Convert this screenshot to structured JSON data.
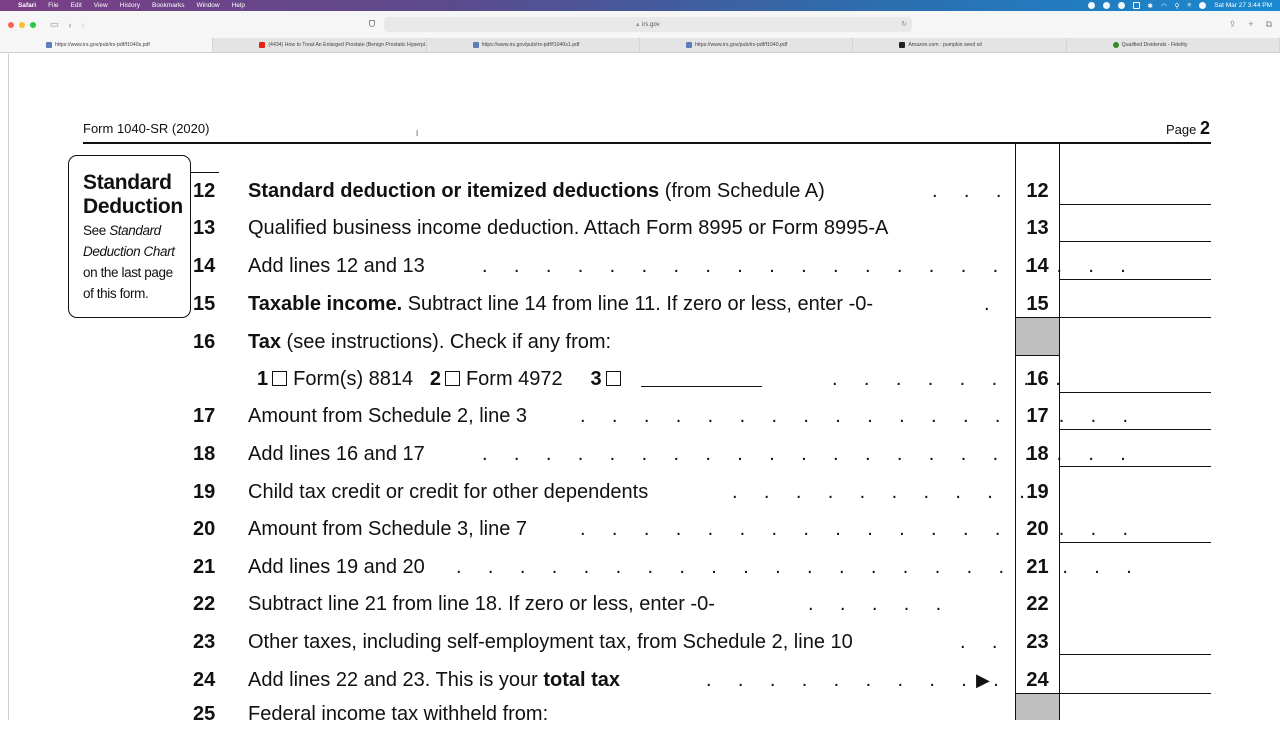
{
  "menubar": {
    "app": "Safari",
    "items": [
      "File",
      "Edit",
      "View",
      "History",
      "Bookmarks",
      "Window",
      "Help"
    ],
    "clock": "Sat Mar 27  3:44 PM"
  },
  "toolbar": {
    "address": "irs.gov",
    "back_icon": "chevron-left",
    "forward_icon": "chevron-right"
  },
  "tabs": [
    {
      "label": "https://www.irs.gov/pub/irs-pdf/f1040s.pdf",
      "favicon": "irs",
      "active": true
    },
    {
      "label": "(4434) How to Treat An Enlarged Prostate (Benign Prostatic Hyperpl...",
      "favicon": "youtube",
      "active": false
    },
    {
      "label": "https://www.irs.gov/pub/irs-pdf/f1040s1.pdf",
      "favicon": "irs",
      "active": false
    },
    {
      "label": "https://www.irs.gov/pub/irs-pdf/f1040.pdf",
      "favicon": "irs",
      "active": false
    },
    {
      "label": "Amazon.com : pumpkin seed oil",
      "favicon": "amazon",
      "active": false
    },
    {
      "label": "Qualified Dividends - Fidelity",
      "favicon": "fidelity",
      "active": false
    }
  ],
  "form": {
    "title": "Form 1040-SR (2020)",
    "page_prefix": "Page",
    "page_number": "2",
    "std_box": {
      "heading_1": "Standard",
      "heading_2": "Deduction",
      "see": "See",
      "italic_1": "Standard",
      "italic_2": "Deduction Chart",
      "rest_1": "on the last page",
      "rest_2": "of this form."
    },
    "lines": [
      {
        "num": "12",
        "bold": "Standard deduction or itemized deductions",
        "text": " (from Schedule A)",
        "dots": ". . .",
        "ref": "12"
      },
      {
        "num": "13",
        "bold": "",
        "text": "Qualified business income deduction. Attach Form 8995 or Form 8995-A",
        "dots": "",
        "ref": "13"
      },
      {
        "num": "14",
        "bold": "",
        "text": "Add lines 12 and 13",
        "dots": ". . . . . . . . . . . . . . . . . . . . .",
        "ref": "14"
      },
      {
        "num": "15",
        "bold": "Taxable income.",
        "text": " Subtract line 14 from line 11. If zero or less, enter -0-",
        "dots": ".",
        "ref": "15"
      },
      {
        "num": "16",
        "bold": "Tax",
        "text": " (see instructions). Check if any from:",
        "dots": "",
        "ref": ""
      },
      {
        "num": "",
        "bold": "",
        "text": "",
        "dots": ". . . . . . . .",
        "ref": "16"
      },
      {
        "num": "17",
        "bold": "",
        "text": "Amount from Schedule 2, line 3",
        "dots": ". . . . . . . . . . . . . . . . . .",
        "ref": "17"
      },
      {
        "num": "18",
        "bold": "",
        "text": "Add lines 16 and 17",
        "dots": ". . . . . . . . . . . . . . . . . . . . .",
        "ref": "18"
      },
      {
        "num": "19",
        "bold": "",
        "text": "Child tax credit or credit for other dependents",
        "dots": ". . . . . . . . . .",
        "ref": "19"
      },
      {
        "num": "20",
        "bold": "",
        "text": "Amount from Schedule 3, line 7",
        "dots": ". . . . . . . . . . . . . . . . . .",
        "ref": "20"
      },
      {
        "num": "21",
        "bold": "",
        "text": "Add lines 19 and 20",
        "dots": ". . . . . . . . . . . . . . . . . . . . . .",
        "ref": "21"
      },
      {
        "num": "22",
        "bold": "",
        "text": "Subtract line 21 from line 18. If zero or less, enter -0-",
        "dots": ". . . . .",
        "ref": "22"
      },
      {
        "num": "23",
        "bold": "",
        "text": "Other taxes, including self-employment tax, from Schedule 2, line 10",
        "dots": ". .",
        "ref": "23"
      },
      {
        "num": "24",
        "bold": "",
        "text": "Add lines 22 and 23. This is your ",
        "bold_after": "total tax",
        "dots": ". . . . . . . . . . .",
        "ref": "24"
      },
      {
        "num": "25",
        "bold": "",
        "text": "Federal income tax withheld from:",
        "dots": "",
        "ref": ""
      }
    ],
    "line16_checks": {
      "c1_num": "1",
      "c1_label": "Form(s) 8814",
      "c2_num": "2",
      "c2_label": "Form 4972",
      "c3_num": "3"
    },
    "arrow": "▶"
  }
}
